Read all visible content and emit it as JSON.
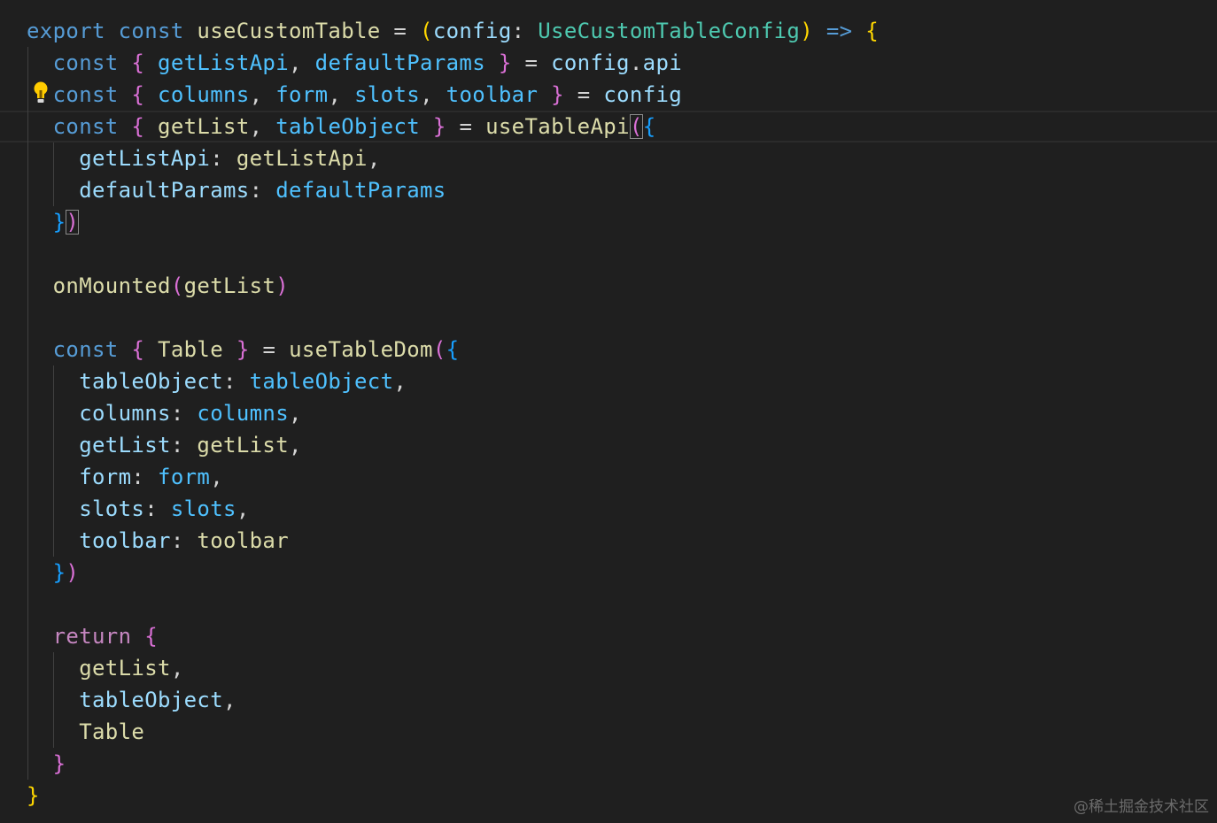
{
  "editor": {
    "background": "#1f1f1f",
    "lines": [
      [
        [
          "export ",
          "kw"
        ],
        [
          "const ",
          "kw"
        ],
        [
          "useCustomTable",
          "fn"
        ],
        [
          " = ",
          "punc"
        ],
        [
          "(",
          "b1"
        ],
        [
          "config",
          "var"
        ],
        [
          ": ",
          "punc"
        ],
        [
          "UseCustomTableConfig",
          "type"
        ],
        [
          ")",
          "b1"
        ],
        [
          " => ",
          "kw"
        ],
        [
          "{",
          "b1"
        ]
      ],
      [
        [
          "  "
        ],
        [
          "const ",
          "kw"
        ],
        [
          "{",
          "b2"
        ],
        [
          " "
        ],
        [
          "getListApi",
          "const"
        ],
        [
          ", ",
          "punc"
        ],
        [
          "defaultParams",
          "const"
        ],
        [
          " "
        ],
        [
          "}",
          "b2"
        ],
        [
          " = ",
          "punc"
        ],
        [
          "config",
          "var"
        ],
        [
          ".",
          "punc"
        ],
        [
          "api",
          "prop"
        ]
      ],
      [
        [
          "  "
        ],
        [
          "const ",
          "kw"
        ],
        [
          "{",
          "b2"
        ],
        [
          " "
        ],
        [
          "columns",
          "const"
        ],
        [
          ", ",
          "punc"
        ],
        [
          "form",
          "const"
        ],
        [
          ", ",
          "punc"
        ],
        [
          "slots",
          "const"
        ],
        [
          ", ",
          "punc"
        ],
        [
          "toolbar",
          "const"
        ],
        [
          " "
        ],
        [
          "}",
          "b2"
        ],
        [
          " = ",
          "punc"
        ],
        [
          "config",
          "var"
        ]
      ],
      [
        [
          "  "
        ],
        [
          "const ",
          "kw"
        ],
        [
          "{",
          "b2"
        ],
        [
          " "
        ],
        [
          "getList",
          "fn"
        ],
        [
          ", ",
          "punc"
        ],
        [
          "tableObject",
          "const"
        ],
        [
          " "
        ],
        [
          "}",
          "b2"
        ],
        [
          " = ",
          "punc"
        ],
        [
          "useTableApi",
          "fn"
        ],
        [
          "(",
          "b2",
          "match"
        ],
        [
          "{",
          "b3"
        ]
      ],
      [
        [
          "    "
        ],
        [
          "getListApi",
          "prop"
        ],
        [
          ": ",
          "punc"
        ],
        [
          "getListApi",
          "fn"
        ],
        [
          ",",
          "punc"
        ]
      ],
      [
        [
          "    "
        ],
        [
          "defaultParams",
          "prop"
        ],
        [
          ": ",
          "punc"
        ],
        [
          "defaultParams",
          "const"
        ]
      ],
      [
        [
          "  "
        ],
        [
          "}",
          "b3"
        ],
        [
          ")",
          "b2",
          "match"
        ]
      ],
      [
        [
          ""
        ]
      ],
      [
        [
          "  "
        ],
        [
          "onMounted",
          "fn"
        ],
        [
          "(",
          "b2"
        ],
        [
          "getList",
          "fn"
        ],
        [
          ")",
          "b2"
        ]
      ],
      [
        [
          ""
        ]
      ],
      [
        [
          "  "
        ],
        [
          "const ",
          "kw"
        ],
        [
          "{",
          "b2"
        ],
        [
          " "
        ],
        [
          "Table",
          "fn"
        ],
        [
          " "
        ],
        [
          "}",
          "b2"
        ],
        [
          " = ",
          "punc"
        ],
        [
          "useTableDom",
          "fn"
        ],
        [
          "(",
          "b2"
        ],
        [
          "{",
          "b3"
        ]
      ],
      [
        [
          "    "
        ],
        [
          "tableObject",
          "prop"
        ],
        [
          ": ",
          "punc"
        ],
        [
          "tableObject",
          "const"
        ],
        [
          ",",
          "punc"
        ]
      ],
      [
        [
          "    "
        ],
        [
          "columns",
          "prop"
        ],
        [
          ": ",
          "punc"
        ],
        [
          "columns",
          "const"
        ],
        [
          ",",
          "punc"
        ]
      ],
      [
        [
          "    "
        ],
        [
          "getList",
          "prop"
        ],
        [
          ": ",
          "punc"
        ],
        [
          "getList",
          "fn"
        ],
        [
          ",",
          "punc"
        ]
      ],
      [
        [
          "    "
        ],
        [
          "form",
          "prop"
        ],
        [
          ": ",
          "punc"
        ],
        [
          "form",
          "const"
        ],
        [
          ",",
          "punc"
        ]
      ],
      [
        [
          "    "
        ],
        [
          "slots",
          "prop"
        ],
        [
          ": ",
          "punc"
        ],
        [
          "slots",
          "const"
        ],
        [
          ",",
          "punc"
        ]
      ],
      [
        [
          "    "
        ],
        [
          "toolbar",
          "prop"
        ],
        [
          ": ",
          "punc"
        ],
        [
          "toolbar",
          "fn"
        ]
      ],
      [
        [
          "  "
        ],
        [
          "}",
          "b3"
        ],
        [
          ")",
          "b2"
        ]
      ],
      [
        [
          ""
        ]
      ],
      [
        [
          "  "
        ],
        [
          "return ",
          "ctrl"
        ],
        [
          "{",
          "b2"
        ]
      ],
      [
        [
          "    "
        ],
        [
          "getList",
          "fn"
        ],
        [
          ",",
          "punc"
        ]
      ],
      [
        [
          "    "
        ],
        [
          "tableObject",
          "var"
        ],
        [
          ",",
          "punc"
        ]
      ],
      [
        [
          "    "
        ],
        [
          "Table",
          "fn"
        ]
      ],
      [
        [
          "  "
        ],
        [
          "}",
          "b2"
        ]
      ],
      [
        [
          "}",
          "b1"
        ]
      ]
    ]
  },
  "watermark": "@稀土掘金技术社区"
}
